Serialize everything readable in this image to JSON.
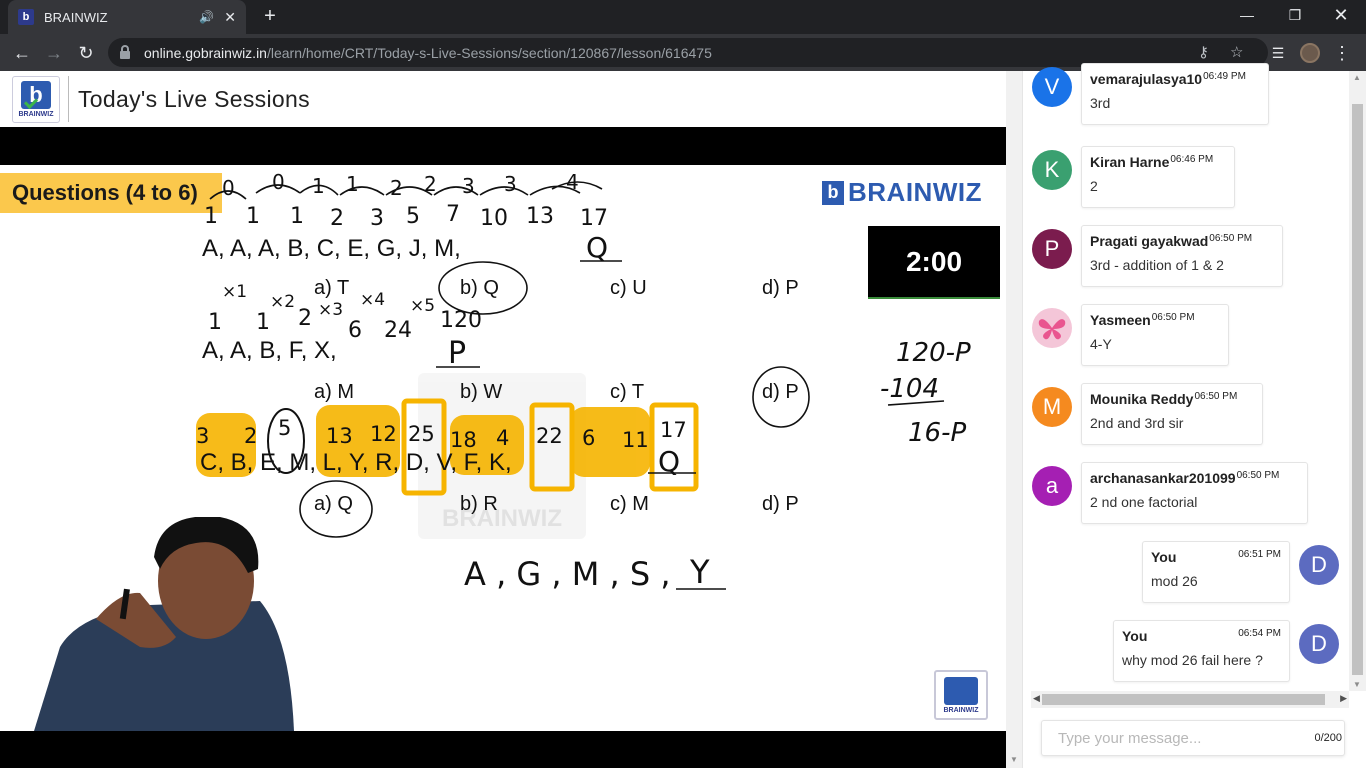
{
  "browser": {
    "tab_title": "BRAINWIZ",
    "tab_favicon": "b",
    "new_tab": "+",
    "url_host": "online.gobrainwiz.in",
    "url_path": "/learn/home/CRT/Today-s-Live-Sessions/section/120867/lesson/616475"
  },
  "header": {
    "logo_text": "BRAINWIZ",
    "title": "Today's Live Sessions"
  },
  "slide": {
    "banner": "Questions (4 to 6)",
    "brand": "BRAINWIZ",
    "timer": "2:00",
    "q1_series": "A,  A,  A,  B,  C,  E,  G,  J,  M,",
    "q1_options": [
      "a) T",
      "b) Q",
      "c) U",
      "d) P"
    ],
    "q2_series": "A,   A,   B,   F,   X,",
    "q2_options": [
      "a) M",
      "b) W",
      "c) T",
      "d) P"
    ],
    "q3_series": "C,  B,  E,  M,  L,  Y,  R,  D,  V,  F,  K,",
    "q3_options": [
      "a) Q",
      "b) R",
      "c) M",
      "d) P"
    ],
    "watermark": "BRAINWIZ",
    "logo_small": "BRAINWIZ",
    "handwriting": {
      "q1_diffs": [
        "0",
        "0",
        "1",
        "1",
        "2",
        "2",
        "3",
        "3",
        "4"
      ],
      "q1_nums": [
        "1",
        "1",
        "1",
        "2",
        "3",
        "5",
        "7",
        "10",
        "13",
        "17"
      ],
      "q1_answer": "Q",
      "q2_ops": [
        "×1",
        "×2",
        "×3",
        "×4",
        "×5"
      ],
      "q2_nums": [
        "1",
        "1",
        "2",
        "6",
        "24",
        "120"
      ],
      "q2_answer": "P",
      "q3_nums": [
        "3",
        "2",
        "5",
        "13",
        "12",
        "25",
        "18",
        "4",
        "22",
        "6",
        "11",
        "17"
      ],
      "q3_answer": "Q",
      "side_calc": [
        "120-P",
        "-104",
        "16-P"
      ],
      "bottom_series": "A , G , M , S ,",
      "bottom_answer": "Y"
    }
  },
  "chat": {
    "messages": [
      {
        "initial": "V",
        "color": "#1a73e8",
        "name": "vemarajulasya10",
        "time": "06:49 PM",
        "text": "3rd",
        "mine": false
      },
      {
        "initial": "K",
        "color": "#3aa070",
        "name": "Kiran Harne",
        "time": "06:46 PM",
        "text": "2",
        "mine": false
      },
      {
        "initial": "P",
        "color": "#7b1c4e",
        "name": "Pragati gayakwad",
        "time": "06:50 PM",
        "text": "3rd - addition of 1 & 2",
        "mine": false
      },
      {
        "initial": "",
        "color": "#f4c6d8",
        "name": "Yasmeen",
        "time": "06:50 PM",
        "text": "4-Y",
        "mine": false
      },
      {
        "initial": "M",
        "color": "#f58a1f",
        "name": "Mounika Reddy",
        "time": "06:50 PM",
        "text": "2nd and 3rd sir",
        "mine": false
      },
      {
        "initial": "a",
        "color": "#a51fb3",
        "name": "archanasankar201099",
        "time": "06:50 PM",
        "text": "2 nd one factorial",
        "mine": false
      },
      {
        "initial": "D",
        "color": "#5c6bc0",
        "name": "You",
        "time": "06:51 PM",
        "text": "mod 26",
        "mine": true
      },
      {
        "initial": "D",
        "color": "#5c6bc0",
        "name": "You",
        "time": "06:54 PM",
        "text": "why mod 26 fail here ?",
        "mine": true
      }
    ],
    "input_placeholder": "Type your message...",
    "input_value": "",
    "counter": "0/200"
  }
}
